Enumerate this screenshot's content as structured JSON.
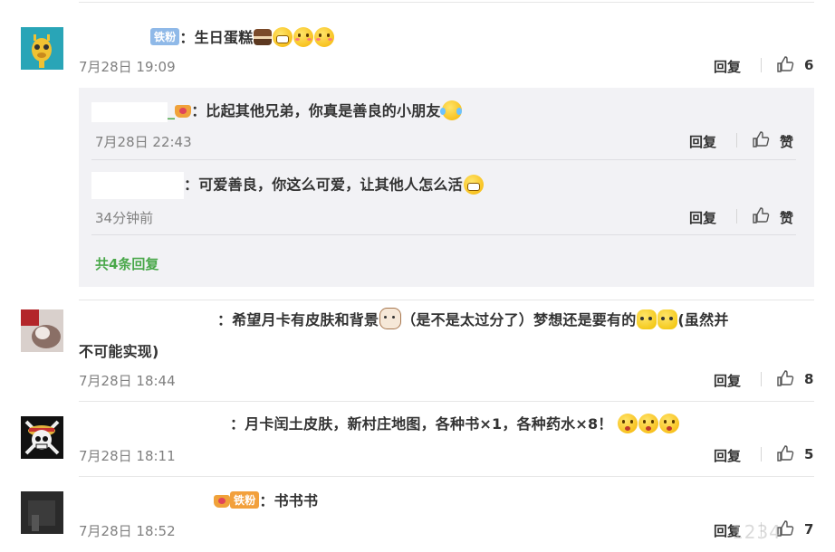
{
  "comments": [
    {
      "name": "",
      "badge": "铁粉",
      "text": "：生日蛋糕",
      "time": "7月28日 19:09",
      "reply_label": "回复",
      "like_count": "6"
    },
    {
      "name": "",
      "text_line1": "：希望月卡有皮肤和背景",
      "text_mid": "（是不是太过分了）梦想还是要有的",
      "text_end": "(虽然并",
      "text_line2": "不可能实现)",
      "time": "7月28日 18:44",
      "reply_label": "回复",
      "like_count": "8"
    },
    {
      "name": "",
      "text": "：月卡闰土皮肤，新村庄地图，各种书×1，各种药水×8！",
      "time": "7月28日 18:11",
      "reply_label": "回复",
      "like_count": "5"
    },
    {
      "name": "",
      "badge": "铁粉",
      "text": "：书书书",
      "time": "7月28日 18:52",
      "reply_label": "回复",
      "like_count": "7"
    }
  ],
  "replies": [
    {
      "name_suffix": "_",
      "text": "：比起其他兄弟，你真是善良的小朋友",
      "time": "7月28日 22:43",
      "reply_label": "回复",
      "like_label": "赞"
    },
    {
      "text": "：可爱善良，你这么可爱，让其他人怎么活",
      "time": "34分钟前",
      "reply_label": "回复",
      "like_label": "赞"
    }
  ],
  "more_replies": "共4条回复",
  "watermark": "1234"
}
